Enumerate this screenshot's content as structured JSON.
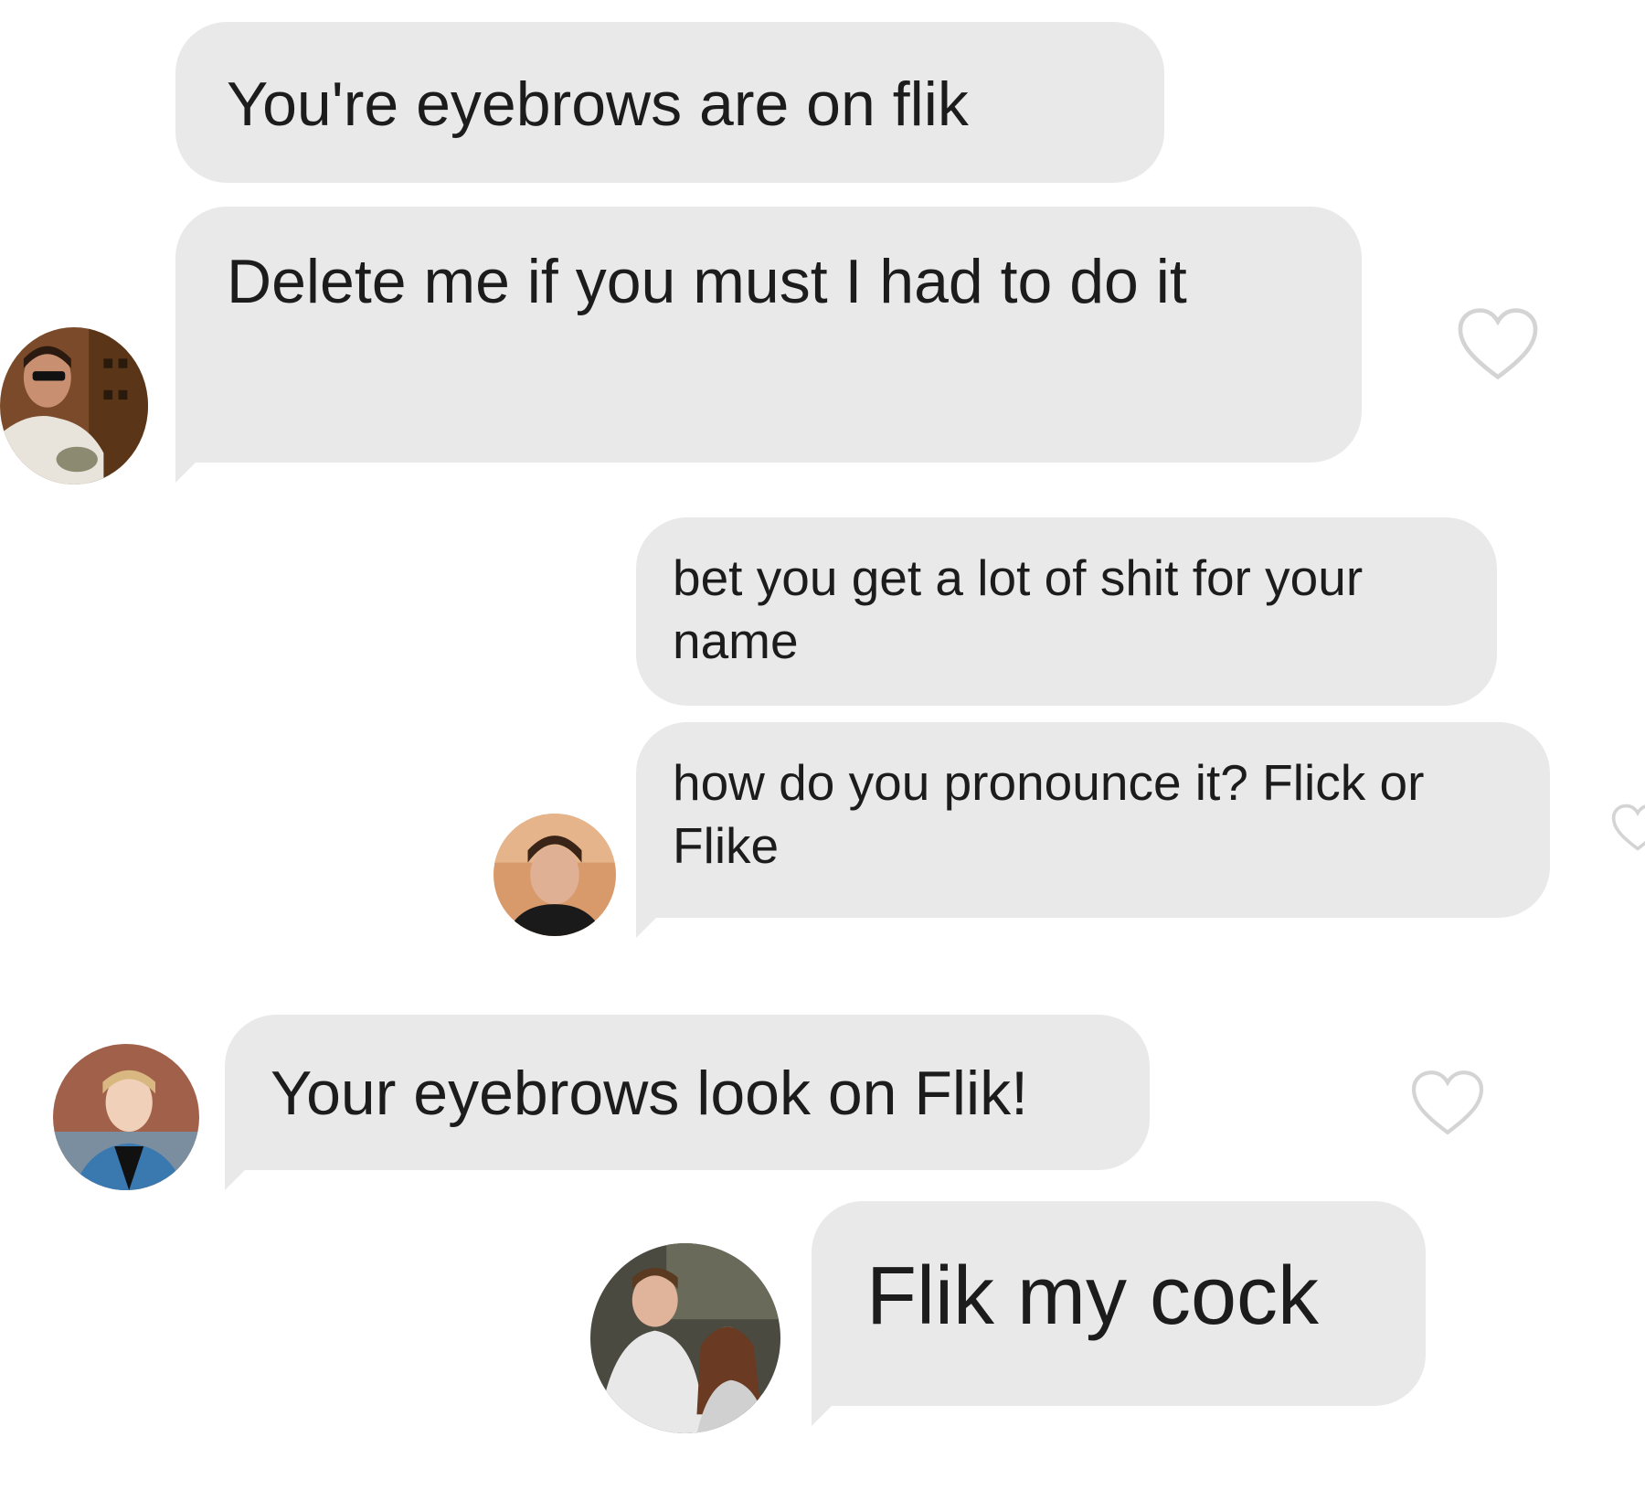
{
  "conversation": {
    "messages": [
      {
        "text": "You're eyebrows are on flik"
      },
      {
        "text": "Delete me if you must I had to do it"
      },
      {
        "text": "bet you get a lot of shit for your name"
      },
      {
        "text": "how do you pronounce it? Flick or Flike"
      },
      {
        "text": "Your eyebrows look on Flik!"
      },
      {
        "text": "Flik my cock"
      }
    ]
  },
  "icons": {
    "like": "heart-outline-icon"
  },
  "colors": {
    "bubble": "#e9e9e9",
    "heart_outline": "#d0d0d0",
    "background": "#ffffff"
  }
}
